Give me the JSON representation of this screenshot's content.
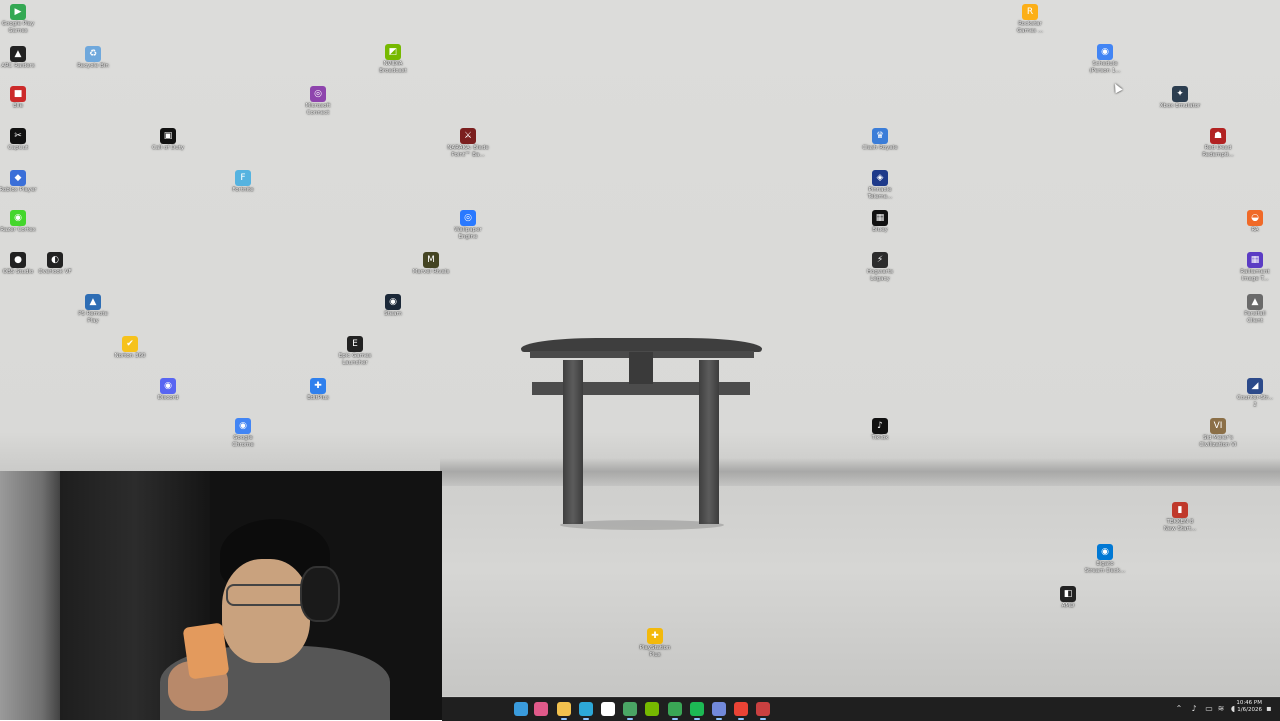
{
  "desktop": {
    "icons": [
      {
        "label": "Google Play\nGames",
        "color": "#34a853",
        "glyph": "▶"
      },
      {
        "label": "ARC Raiders",
        "color": "#222222",
        "glyph": "▲"
      },
      {
        "label": "Recycle Bin",
        "color": "#6fa8dc",
        "glyph": "♻"
      },
      {
        "label": "NVIDIA\nBroadcast",
        "color": "#76b900",
        "glyph": "◩"
      },
      {
        "label": "Rockstar\nGames ...",
        "color": "#fcaf17",
        "glyph": "R"
      },
      {
        "label": "Schedule\n(Person 1...",
        "color": "#4285f4",
        "glyph": "◉"
      },
      {
        "label": "Elle",
        "color": "#cc2a2a",
        "glyph": "■"
      },
      {
        "label": "Microsoft\nConnect",
        "color": "#8e44ad",
        "glyph": "◎"
      },
      {
        "label": "Xbox Emulator",
        "color": "#2c3e50",
        "glyph": "✦"
      },
      {
        "label": "CapCut",
        "color": "#111111",
        "glyph": "✂"
      },
      {
        "label": "Call of Duty",
        "color": "#111111",
        "glyph": "▣"
      },
      {
        "label": "NARAKA: Blade\nPoint™ Ba...",
        "color": "#7b1f1f",
        "glyph": "⚔"
      },
      {
        "label": "Clash Royale",
        "color": "#3b7dd8",
        "glyph": "♛"
      },
      {
        "label": "Red Dead\nRedempti...",
        "color": "#b22222",
        "glyph": "☗"
      },
      {
        "label": "Roblox Player",
        "color": "#3a6fd8",
        "glyph": "◆"
      },
      {
        "label": "Fortnite",
        "color": "#55b3e0",
        "glyph": "F"
      },
      {
        "label": "Pinnacle\nTeleme...",
        "color": "#1e3a8a",
        "glyph": "◈"
      },
      {
        "label": "Razer Cortex",
        "color": "#44d62c",
        "glyph": "◉"
      },
      {
        "label": "Wallpaper\nEngine",
        "color": "#2979ff",
        "glyph": "◎"
      },
      {
        "label": "Bluey",
        "color": "#111111",
        "glyph": "▦"
      },
      {
        "label": "Hogwarts\nLegacy",
        "color": "#2b2b2b",
        "glyph": "⚡"
      },
      {
        "label": "RA",
        "color": "#f06a28",
        "glyph": "◒"
      },
      {
        "label": "OBS Studio",
        "color": "#222222",
        "glyph": "●"
      },
      {
        "label": "Overlook VF",
        "color": "#222222",
        "glyph": "◐"
      },
      {
        "label": "Marvel Rivals",
        "color": "#444422",
        "glyph": "M"
      },
      {
        "label": "Ralliament\nImage T...",
        "color": "#5b3cc4",
        "glyph": "▦"
      },
      {
        "label": "PS Remote\nPlay",
        "color": "#2e6db4",
        "glyph": "▲"
      },
      {
        "label": "Steam",
        "color": "#1b2838",
        "glyph": "◉"
      },
      {
        "label": "Parsifall\nClient",
        "color": "#6a6a6a",
        "glyph": "▲"
      },
      {
        "label": "Norton 360",
        "color": "#f6c21c",
        "glyph": "✔"
      },
      {
        "label": "Epic Games\nLauncher",
        "color": "#222222",
        "glyph": "E"
      },
      {
        "label": "Discord",
        "color": "#5865f2",
        "glyph": "◉"
      },
      {
        "label": "EditPlus",
        "color": "#2f80ed",
        "glyph": "✚"
      },
      {
        "label": "Counter-Str...\n2",
        "color": "#2c4a8a",
        "glyph": "◢"
      },
      {
        "label": "Google\nChrome",
        "color": "#4285f4",
        "glyph": "◉"
      },
      {
        "label": "TikTok",
        "color": "#111111",
        "glyph": "♪"
      },
      {
        "label": "Sid Meier's\nCivilization VI",
        "color": "#8b6f47",
        "glyph": "VI"
      },
      {
        "label": "TEKKEN 8\nNew Start...",
        "color": "#c0392b",
        "glyph": "▮"
      },
      {
        "label": "Elgato\nStream Deck...",
        "color": "#0078d4",
        "glyph": "◉"
      },
      {
        "label": "AMD",
        "color": "#222222",
        "glyph": "◧"
      },
      {
        "label": "PlayStation\nPlus",
        "color": "#f3b90b",
        "glyph": "✚"
      }
    ]
  },
  "webcam": {
    "description_alt": "streamer webcam"
  },
  "taskbar": {
    "pinned": [
      {
        "name": "start",
        "color": "#3a9bdc"
      },
      {
        "name": "copilot",
        "color": "#e05a8a"
      },
      {
        "name": "file-explorer",
        "color": "#f2c14e"
      },
      {
        "name": "edge",
        "color": "#2da8d8"
      },
      {
        "name": "store",
        "color": "#ffffff"
      },
      {
        "name": "media",
        "color": "#4aa564"
      },
      {
        "name": "nvidia",
        "color": "#76b900"
      },
      {
        "name": "xbox",
        "color": "#3aa655"
      },
      {
        "name": "spotify",
        "color": "#1db954"
      },
      {
        "name": "discord",
        "color": "#7289da"
      },
      {
        "name": "chrome",
        "color": "#ea4335"
      },
      {
        "name": "recording",
        "color": "#c94040"
      }
    ],
    "clock": {
      "time": "10:46 PM",
      "date": "1/6/2026"
    }
  }
}
